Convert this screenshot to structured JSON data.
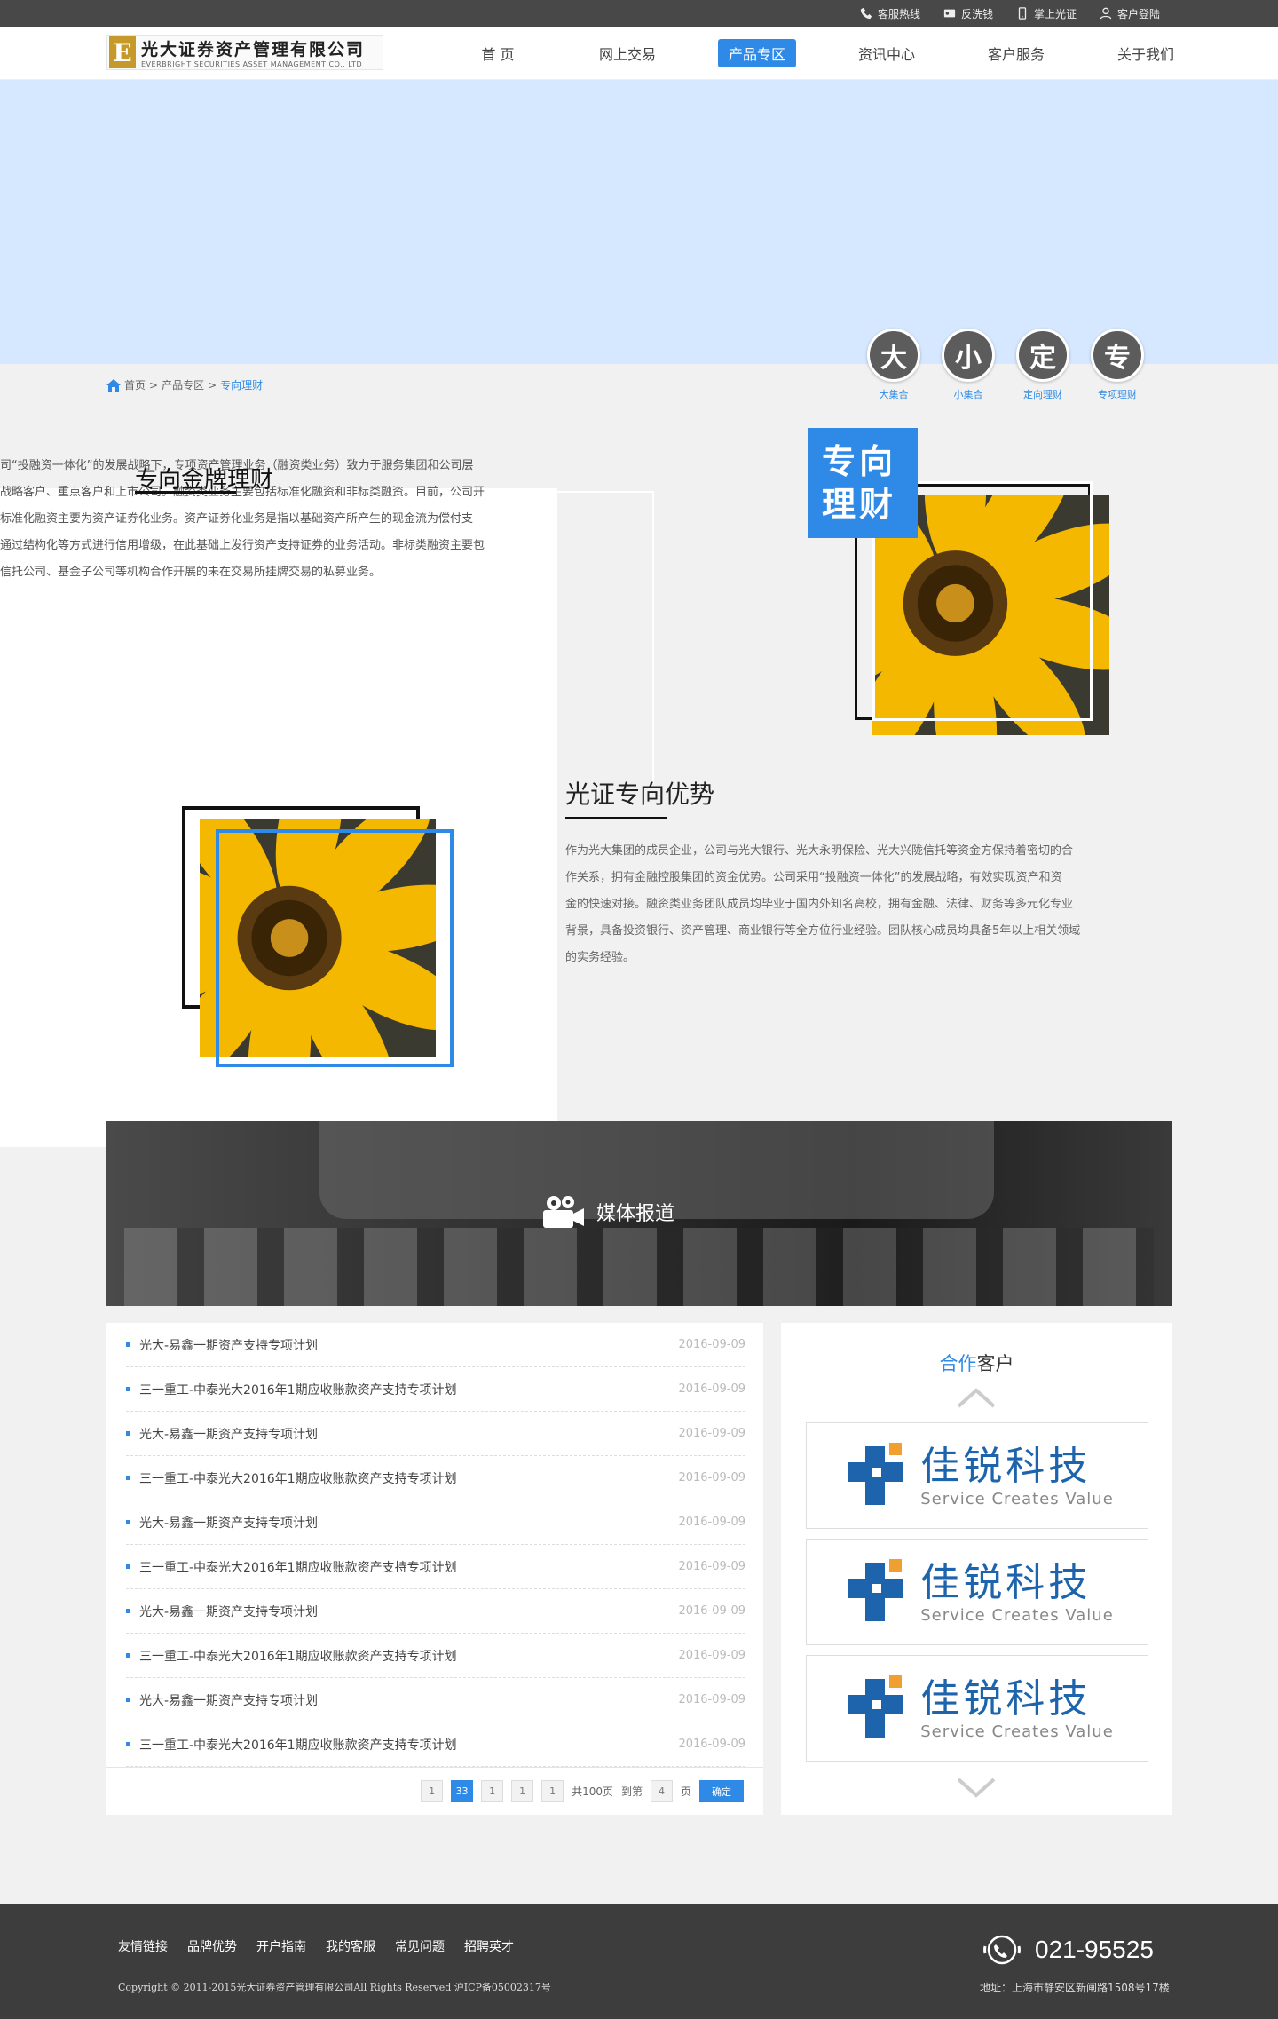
{
  "topbar": {
    "links": [
      {
        "label": "客服热线",
        "icon": "phone-icon"
      },
      {
        "label": "反洗钱",
        "icon": "ticket-icon"
      },
      {
        "label": "掌上光证",
        "icon": "mobile-icon"
      },
      {
        "label": "客户登陆",
        "icon": "user-icon"
      }
    ]
  },
  "logo": {
    "mark": "E",
    "name_cn": "光大证券资产管理有限公司",
    "name_en": "EVERBRIGHT SECURITIES ASSET MANAGEMENT CO., LTD"
  },
  "nav": {
    "items": [
      "首 页",
      "网上交易",
      "产品专区",
      "资讯中心",
      "客户服务",
      "关于我们"
    ],
    "active": "产品专区"
  },
  "categories": [
    {
      "char": "大",
      "label": "大集合"
    },
    {
      "char": "小",
      "label": "小集合"
    },
    {
      "char": "定",
      "label": "定向理财"
    },
    {
      "char": "专",
      "label": "专项理财"
    }
  ],
  "breadcrumb": {
    "home": "首页",
    "sep": ">",
    "level2": "产品专区",
    "current": "专向理财"
  },
  "intro": {
    "title": "专向金牌理财",
    "lines": [
      "司“投融资一体化”的发展战略下，专项资产管理业务（融资类业务）致力于服务集团和公司层",
      "战略客户、重点客户和上市公司。融资类业务主要包括标准化融资和非标类融资。目前，公司开",
      "标准化融资主要为资产证券化业务。资产证券化业务是指以基础资产所产生的现金流为偿付支",
      "通过结构化等方式进行信用增级，在此基础上发行资产支持证券的业务活动。非标类融资主要包",
      "信托公司、基金子公司等机构合作开展的未在交易所挂牌交易的私募业务。"
    ]
  },
  "tag": {
    "line1": "专向",
    "line2": "理财"
  },
  "advantage": {
    "title": "光证专向优势",
    "lines": [
      "作为光大集团的成员企业，公司与光大银行、光大永明保险、光大兴陇信托等资金方保持着密切的合",
      "作关系，拥有金融控股集团的资金优势。公司采用“投融资一体化”的发展战略，有效实现资产和资",
      "金的快速对接。融资类业务团队成员均毕业于国内外知名高校，拥有金融、法律、财务等多元化专业",
      "背景，具备投资银行、资产管理、商业银行等全方位行业经验。团队核心成员均具备5年以上相关领域",
      "的实务经验。"
    ]
  },
  "media": {
    "label": "媒体报道",
    "icon": "video-camera-icon"
  },
  "news": {
    "items": [
      {
        "title": "光大-易鑫一期资产支持专项计划",
        "date": "2016-09-09"
      },
      {
        "title": "三一重工-中泰光大2016年1期应收账款资产支持专项计划",
        "date": "2016-09-09"
      },
      {
        "title": "光大-易鑫一期资产支持专项计划",
        "date": "2016-09-09"
      },
      {
        "title": "三一重工-中泰光大2016年1期应收账款资产支持专项计划",
        "date": "2016-09-09"
      },
      {
        "title": "光大-易鑫一期资产支持专项计划",
        "date": "2016-09-09"
      },
      {
        "title": "三一重工-中泰光大2016年1期应收账款资产支持专项计划",
        "date": "2016-09-09"
      },
      {
        "title": "光大-易鑫一期资产支持专项计划",
        "date": "2016-09-09"
      },
      {
        "title": "三一重工-中泰光大2016年1期应收账款资产支持专项计划",
        "date": "2016-09-09"
      },
      {
        "title": "光大-易鑫一期资产支持专项计划",
        "date": "2016-09-09"
      },
      {
        "title": "三一重工-中泰光大2016年1期应收账款资产支持专项计划",
        "date": "2016-09-09"
      }
    ]
  },
  "pager": {
    "pages": [
      "1",
      "33",
      "1",
      "1",
      "1"
    ],
    "current": "33",
    "total": "共100页",
    "goto_label": "到第",
    "goto_value": "4",
    "page_unit": "页",
    "confirm": "确定"
  },
  "partners": {
    "title_highlight": "合作",
    "title_rest": "客户",
    "cards": [
      {
        "name": "佳锐科技",
        "slogan": "Service Creates Value"
      },
      {
        "name": "佳锐科技",
        "slogan": "Service Creates Value"
      },
      {
        "name": "佳锐科技",
        "slogan": "Service Creates Value"
      }
    ]
  },
  "footer": {
    "links": [
      "友情链接",
      "品牌优势",
      "开户指南",
      "我的客服",
      "常见问题",
      "招聘英才"
    ],
    "copyright": "Copyright © 2011-2015光大证券资产管理有限公司All Rights Reserved  沪ICP备05002317号",
    "phone": "021-95525",
    "address": "地址：上海市静安区新闸路1508号17楼"
  },
  "colors": {
    "accent": "#2e8ae6",
    "dark": "#484848",
    "banner": "#d6e8ff"
  }
}
